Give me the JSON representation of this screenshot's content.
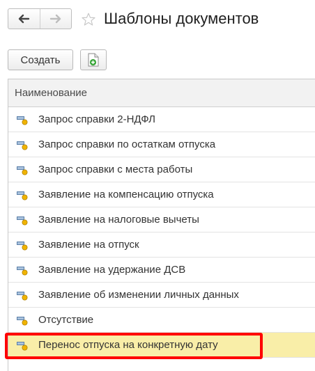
{
  "toolbar": {
    "back_icon": "arrow-left-icon",
    "forward_icon": "arrow-right-icon",
    "favorite_icon": "star-icon",
    "title": "Шаблоны документов",
    "create_label": "Создать",
    "add_document_icon": "document-add-icon"
  },
  "table": {
    "header": "Наименование",
    "row_icon": "template-icon",
    "rows": [
      "Запрос справки 2-НДФЛ",
      "Запрос справки по остаткам отпуска",
      "Запрос справки с места работы",
      "Заявление на компенсацию отпуска",
      "Заявление на налоговые вычеты",
      "Заявление на отпуск",
      "Заявление на удержание ДСВ",
      "Заявление об изменении личных данных",
      "Отсутствие",
      "Перенос отпуска на конкретную дату"
    ],
    "selected_row": 9
  },
  "colors": {
    "selection_background": "#f9eea8",
    "highlight_border": "#ff0000",
    "header_background": "#f2f2f2"
  }
}
